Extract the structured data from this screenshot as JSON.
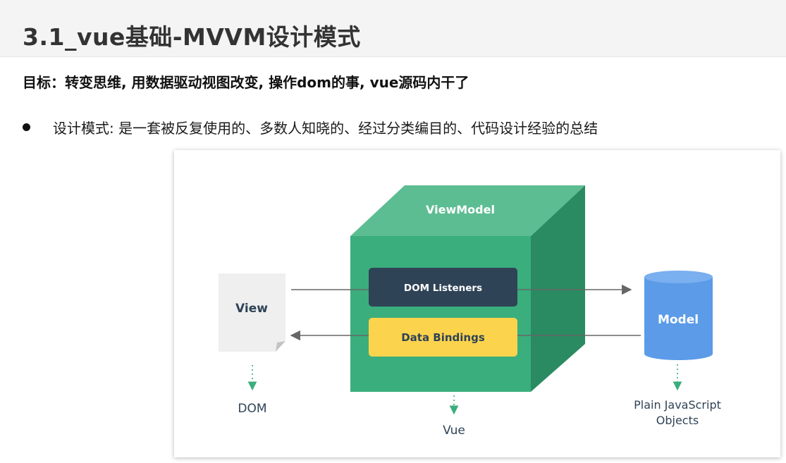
{
  "header": {
    "title": "3.1_vue基础-MVVM设计模式"
  },
  "goal": {
    "text": "目标：转变思维, 用数据驱动视图改变, 操作dom的事, vue源码内干了"
  },
  "bullets": [
    {
      "text": "设计模式: 是一套被反复使用的、多数人知晓的、经过分类编目的、代码设计经验的总结"
    }
  ],
  "diagram": {
    "viewmodel_label": "ViewModel",
    "dom_listeners_label": "DOM Listeners",
    "data_bindings_label": "Data Bindings",
    "view_label": "View",
    "model_label": "Model",
    "dom_label": "DOM",
    "vue_label": "Vue",
    "plain_js_line1": "Plain JavaScript",
    "plain_js_line2": "Objects",
    "colors": {
      "cube_front": "#3aae7c",
      "cube_top": "#5dbd92",
      "cube_side": "#2a8a61",
      "dom_listeners_fill": "#2f4356",
      "data_bindings_fill": "#fcd34d",
      "model_fill": "#5b9be8",
      "view_fill": "#efefef",
      "arrow": "#666666",
      "dotted_arrow": "#3aae7c"
    }
  }
}
